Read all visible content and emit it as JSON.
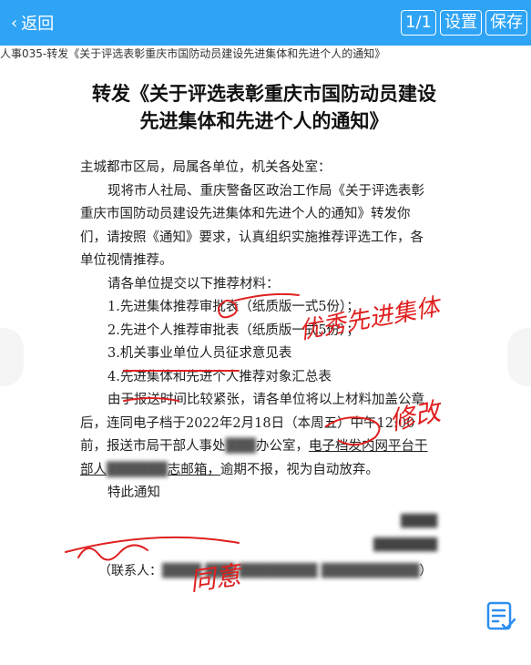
{
  "topbar": {
    "back_label": "返回",
    "page_indicator": "1/1",
    "settings_label": "设置",
    "save_label": "保存"
  },
  "filename": "人事035-转发《关于评选表彰重庆市国防动员建设先进集体和先进个人的通知》",
  "document": {
    "title_line1": "转发《关于评选表彰重庆市国防动员建设",
    "title_line2": "先进集体和先进个人的通知》",
    "body": [
      "主城都市区局，局属各单位，机关各处室：",
      "现将市人社局、重庆警备区政治工作局《关于评选表彰",
      "重庆市国防动员建设先进集体和先进个人的通知》转发你",
      "们，请按照《通知》要求，认真组织实施推荐评选工作，各",
      "单位视情推荐。",
      "请各单位提交以下推荐材料：",
      "1.先进集体推荐审批表（纸质版一式5份）；",
      "2.先进个人推荐审批表（纸质版一式5份）；",
      "3.机关事业单位人员征求意见表",
      "4.先进集体和先进个人推荐对象汇总表",
      "由于报送时间比较紧张，请各单位将以上材料加盖公章",
      "后，连同电子档于2022年2月18日（本周五）中午12:00",
      "前，报送市局干部人事处",
      "部人",
      "特此通知"
    ],
    "line13_mid": "办公室，",
    "line13_tail": "电子档发内网平台干",
    "line14_mid": "志邮箱，",
    "line14_tail": "逾期不报，视为自动放弃。",
    "contact_prefix": "（联系人：",
    "contact_suffix": "）"
  },
  "annotations": {
    "note1": "优秀先进集体",
    "note2": "修改",
    "note3": "同意"
  }
}
